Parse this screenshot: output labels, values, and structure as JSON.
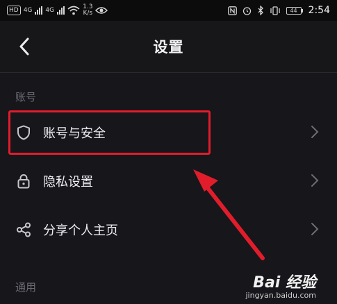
{
  "status": {
    "left_tag": "HD",
    "net1": "4G",
    "net2": "4G",
    "speed_value": "1.3",
    "speed_unit": "K/s",
    "battery": "44",
    "time": "2:54"
  },
  "header": {
    "title": "设置"
  },
  "sections": [
    {
      "label": "账号"
    },
    {
      "label": "通用"
    }
  ],
  "items": [
    {
      "label": "账号与安全",
      "icon": "shield-icon"
    },
    {
      "label": "隐私设置",
      "icon": "lock-icon"
    },
    {
      "label": "分享个人主页",
      "icon": "share-icon"
    }
  ],
  "watermark": {
    "main": "Bai 经验",
    "sub": "jingyan.baidu.com"
  },
  "colors": {
    "background": "#16161b",
    "highlight": "#e11d2b"
  }
}
